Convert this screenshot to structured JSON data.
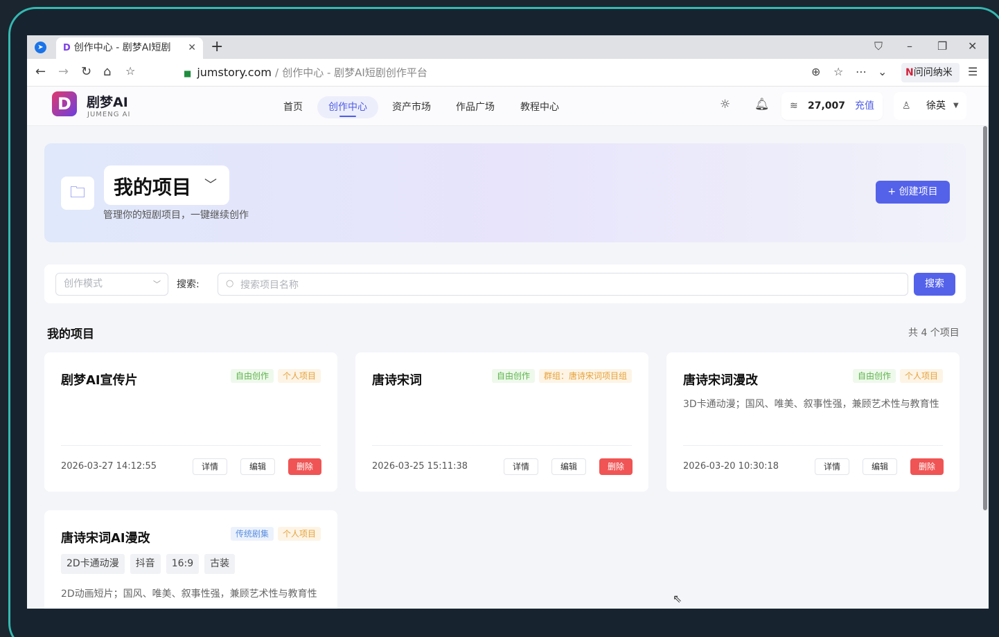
{
  "browser": {
    "tab_title": "创作中心 - 剧梦AI短剧",
    "new_tab": "+",
    "url_domain": "jumstory.com",
    "url_sep": "/",
    "url_title": "创作中心 - 剧梦AI短剧创作平台",
    "extension_label": "问问纳米",
    "extension_mark": "N"
  },
  "app": {
    "logo_mark": "D",
    "logo_name": "剧梦AI",
    "logo_sub": "JUMENG AI",
    "nav": [
      "首页",
      "创作中心",
      "资产市场",
      "作品广场",
      "教程中心"
    ],
    "active_nav": "创作中心",
    "credits": "27,007",
    "topup": "充值",
    "user_name": "徐英"
  },
  "hero": {
    "title": "我的项目",
    "subtitle": "管理你的短剧项目，一键继续创作",
    "create_button": "+ 创建项目"
  },
  "filter": {
    "mode_placeholder": "创作模式",
    "search_label": "搜索:",
    "search_placeholder": "搜索项目名称",
    "search_button": "搜索"
  },
  "section": {
    "title": "我的项目",
    "count": "共 4 个项目"
  },
  "cards": [
    {
      "title": "剧梦AI宣传片",
      "tags": [
        "自由创作",
        "个人项目"
      ],
      "desc": "",
      "date": "2026-03-27 14:12:55",
      "detail": "详情",
      "edit": "编辑",
      "delete": "删除"
    },
    {
      "title": "唐诗宋词",
      "tags": [
        "自由创作",
        "群组：唐诗宋词项目组"
      ],
      "desc": "",
      "date": "2026-03-25 15:11:38",
      "detail": "详情",
      "edit": "编辑",
      "delete": "删除"
    },
    {
      "title": "唐诗宋词漫改",
      "tags": [
        "自由创作",
        "个人项目"
      ],
      "desc": "3D卡通动漫；国风、唯美、叙事性强，兼顾艺术性与教育性",
      "date": "2026-03-20 10:30:18",
      "detail": "详情",
      "edit": "编辑",
      "delete": "删除"
    },
    {
      "title": "唐诗宋词AI漫改",
      "tags": [
        "传统剧集",
        "个人项目"
      ],
      "chips": [
        "2D卡通动漫",
        "抖音",
        "16:9",
        "古装"
      ],
      "desc": "2D动画短片；国风、唯美、叙事性强，兼顾艺术性与教育性"
    }
  ],
  "colors": {
    "accent": "#5462ea",
    "delete": "#f05454",
    "frame": "#35b8b0"
  },
  "icons": {
    "folder": "folder-icon",
    "theme": "sun-icon",
    "notifications": "bell-icon",
    "coins": "coin-stack-icon",
    "avatar": "user-avatar-icon"
  }
}
